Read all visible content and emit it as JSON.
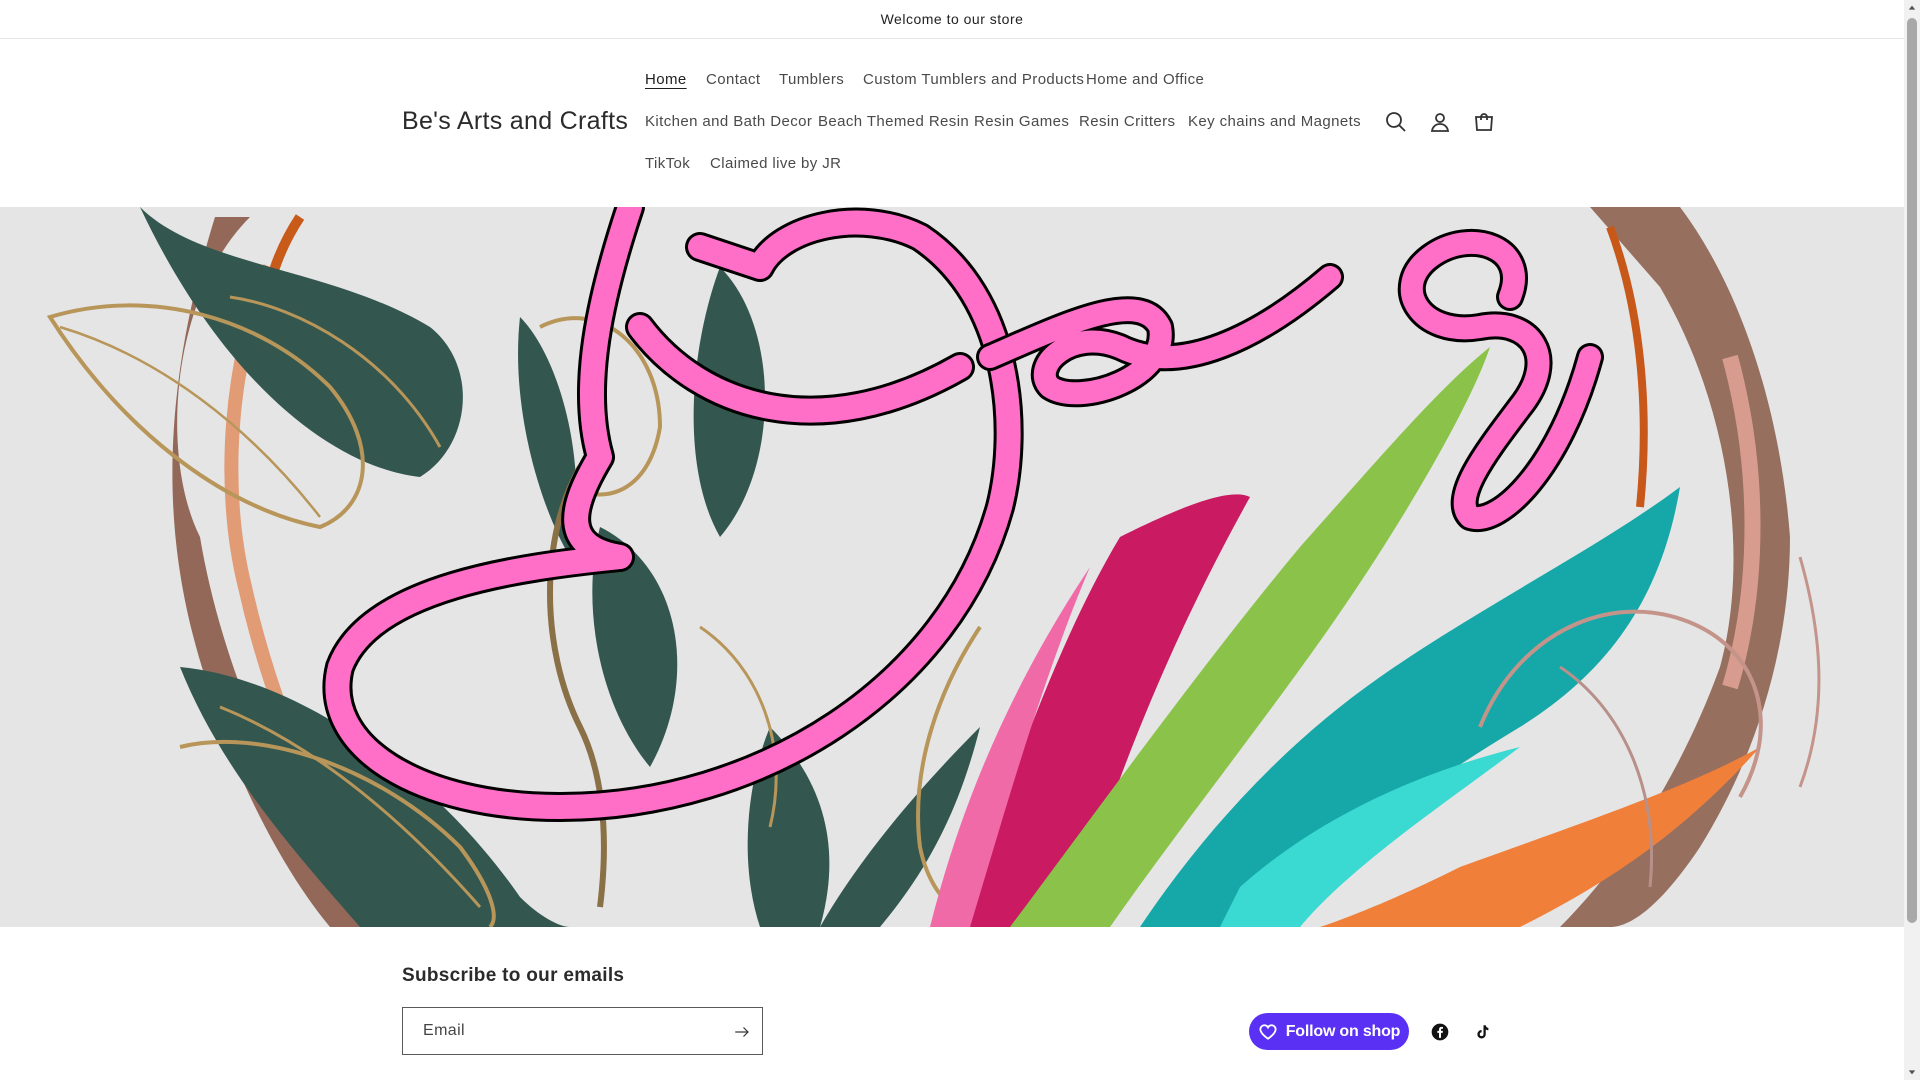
{
  "announcement": {
    "text": "Welcome to our store"
  },
  "header": {
    "logo": "Be's Arts and Crafts",
    "nav": [
      "Home",
      "Contact",
      "Tumblers",
      "Custom Tumblers and Products",
      "Home and Office",
      "Kitchen and Bath Decor",
      "Beach Themed Resin",
      "Resin Games",
      "Resin Critters",
      "Key chains and Magnets",
      "TikTok",
      "Claimed live by JR"
    ],
    "active_nav": "Home",
    "icons": [
      "search-icon",
      "account-icon",
      "cart-icon"
    ]
  },
  "banner": {
    "logo_lettering": "Bes",
    "colors": {
      "background": "#e5e5e5",
      "pink": "#ff6ec7",
      "leaf": "#33574f",
      "gold": "#b8965a",
      "green": "#8bc34a",
      "teal": "#16a8a8",
      "orange": "#f07f3a",
      "brown": "#8a5a48"
    }
  },
  "footer": {
    "subscribe_heading": "Subscribe to our emails",
    "email_placeholder": "Email",
    "follow_label": "Follow on shop",
    "socials": [
      "facebook-icon",
      "tiktok-icon"
    ]
  },
  "colors": {
    "accent": "#5a31f4",
    "text": "#3a3a3a"
  }
}
